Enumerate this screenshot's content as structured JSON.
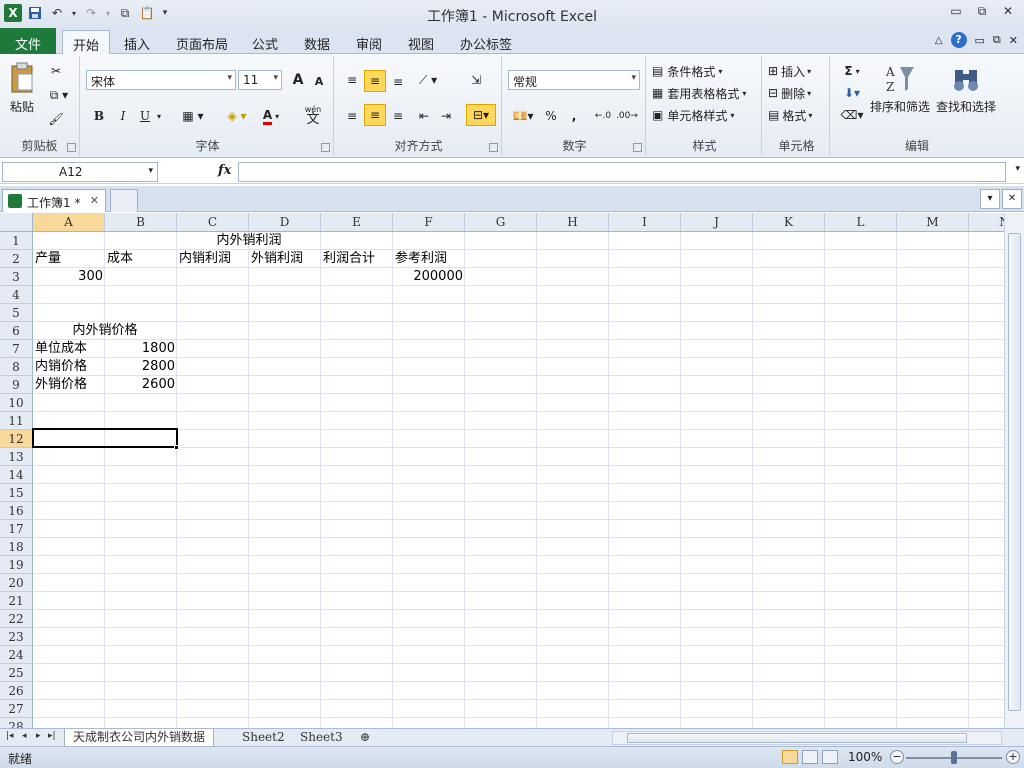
{
  "window": {
    "title": "工作簿1 - Microsoft Excel"
  },
  "qat": {
    "save_icon": "save-icon",
    "undo_icon": "undo-icon",
    "redo_icon": "redo-icon"
  },
  "tabs": [
    {
      "label": "文件"
    },
    {
      "label": "开始"
    },
    {
      "label": "插入"
    },
    {
      "label": "页面布局"
    },
    {
      "label": "公式"
    },
    {
      "label": "数据"
    },
    {
      "label": "审阅"
    },
    {
      "label": "视图"
    },
    {
      "label": "办公标签"
    }
  ],
  "ribbon": {
    "clipboard": {
      "label": "剪贴板",
      "paste": "粘贴"
    },
    "font": {
      "label": "字体",
      "name": "宋体",
      "size": "11",
      "bold": "B",
      "italic": "I",
      "underline": "U",
      "grow": "A",
      "shrink": "A",
      "color": "A",
      "wen": "wén",
      "wen_char": "文"
    },
    "alignment": {
      "label": "对齐方式"
    },
    "number": {
      "label": "数字",
      "format": "常规",
      "percent": "%",
      "comma": ","
    },
    "styles": {
      "label": "样式",
      "conditional": "条件格式",
      "table": "套用表格格式",
      "cell": "单元格样式"
    },
    "cells": {
      "label": "单元格",
      "insert": "插入",
      "delete": "删除",
      "format": "格式"
    },
    "editing": {
      "label": "编辑",
      "sigma": "Σ",
      "sort": "排序和筛选",
      "find": "查找和选择"
    }
  },
  "formula_bar": {
    "name_box": "A12",
    "fx": "fx",
    "value": ""
  },
  "workbook_tab": {
    "label": "工作簿1 *"
  },
  "grid": {
    "columns": [
      "A",
      "B",
      "C",
      "D",
      "E",
      "F",
      "G",
      "H",
      "I",
      "J",
      "K",
      "L",
      "M",
      "N"
    ],
    "rows": [
      "1",
      "2",
      "3",
      "4",
      "5",
      "6",
      "7",
      "8",
      "9",
      "10",
      "11",
      "12",
      "13",
      "14",
      "15",
      "16",
      "17",
      "18",
      "19",
      "20",
      "21",
      "22",
      "23",
      "24",
      "25",
      "26",
      "27",
      "28"
    ],
    "cells": {
      "c1": "内外销利润",
      "a2": "产量",
      "b2": "成本",
      "c2": "内销利润",
      "d2": "外销利润",
      "e2": "利润合计",
      "f2": "参考利润",
      "a3": "300",
      "f3": "200000",
      "a6": "内外销价格",
      "a7": "单位成本",
      "b7": "1800",
      "a8": "内销价格",
      "b8": "2800",
      "a9": "外销价格",
      "b9": "2600"
    }
  },
  "sheets": [
    {
      "name": "天成制衣公司内外销数据"
    },
    {
      "name": "Sheet2"
    },
    {
      "name": "Sheet3"
    }
  ],
  "status": {
    "ready": "就绪",
    "zoom": "100%"
  }
}
